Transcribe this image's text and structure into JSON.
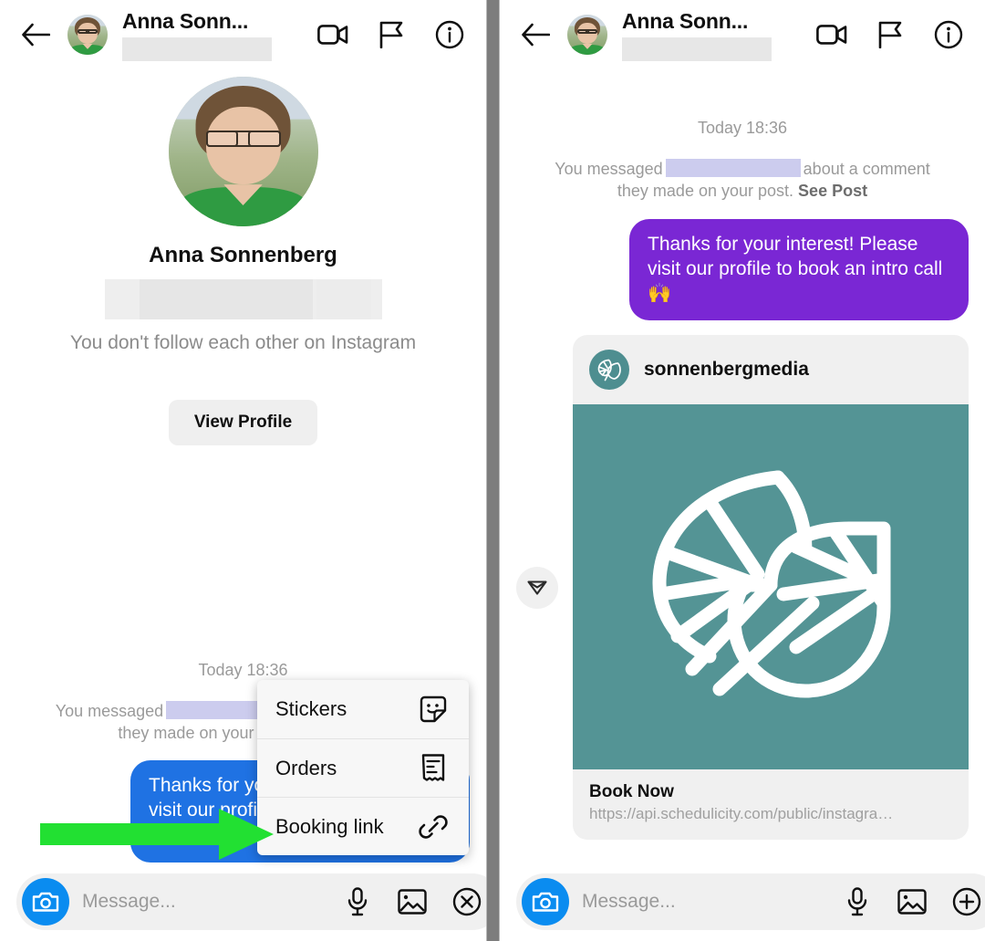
{
  "header": {
    "name": "Anna Sonn...",
    "back_icon": "back-arrow-icon",
    "video_icon": "video-call-icon",
    "flag_icon": "flag-icon",
    "info_icon": "info-icon"
  },
  "profile": {
    "name": "Anna Sonnenberg",
    "follow_status": "You don't follow each other on Instagram",
    "view_profile_label": "View Profile"
  },
  "thread": {
    "day_stamp": "Today 18:36",
    "system_note_prefix": "You messaged",
    "system_note_suffix": "about a comment they made on your post.",
    "see_post_label": "See Post",
    "message_text": "Thanks for your interest! Please visit our profile to book an intro call 🙌"
  },
  "link_card": {
    "handle": "sonnenbergmedia",
    "title": "Book Now",
    "url": "https://api.schedulicity.com/public/instagra…",
    "logo_icon": "leaf-logo-icon",
    "send_icon": "send-plane-icon",
    "image_color": "#549495",
    "logo_color": "#4e8e90"
  },
  "menu": {
    "items": [
      {
        "label": "Stickers",
        "icon": "sticker-icon"
      },
      {
        "label": "Orders",
        "icon": "receipt-icon"
      },
      {
        "label": "Booking link",
        "icon": "link-chain-icon"
      }
    ]
  },
  "composer": {
    "placeholder": "Message...",
    "value": "",
    "camera_icon": "camera-icon",
    "mic_icon": "microphone-icon",
    "gallery_icon": "gallery-icon",
    "close_icon": "close-circle-icon",
    "plus_icon": "plus-circle-icon",
    "camera_color": "#0a8cf0"
  },
  "annotation": {
    "arrow_color": "#22e032"
  },
  "colors": {
    "bubble_left": "#1f72e3",
    "bubble_right": "#7a27d4",
    "divider": "#7d7d7d"
  }
}
